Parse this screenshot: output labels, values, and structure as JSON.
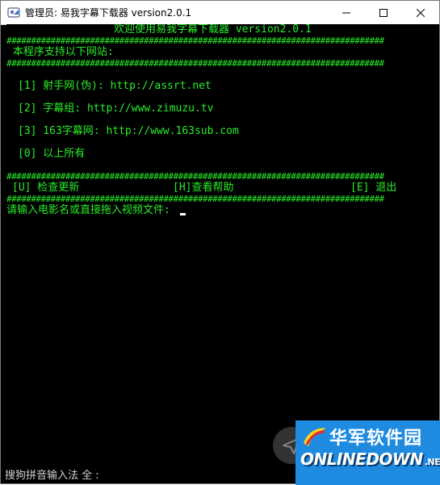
{
  "window": {
    "title": "管理员:  易我字幕下载器 version2.0.1",
    "controls": {
      "minimize": "─",
      "maximize": "☐",
      "close": "✕"
    }
  },
  "console": {
    "welcome": "欢迎使用易我字幕下载器 version2.0.1",
    "hash_line": "#############################################################################",
    "sites_header": " 本程序支持以下网站:",
    "sites": [
      "[1] 射手网(伪): http://assrt.net",
      "[2] 字幕组: http://www.zimuzu.tv",
      "[3] 163字幕网: http://www.163sub.com",
      "[0] 以上所有"
    ],
    "menu": {
      "update": "[U] 检查更新",
      "help": "[H]查看帮助",
      "exit": "[E] 退出"
    },
    "prompt": "请输入电影名或直接拖入视频文件: "
  },
  "ime_status": "搜狗拼音输入法 全 :",
  "watermark": {
    "cn": "华军软件园",
    "en": "ONLINEDOWN",
    "suffix": ".NET"
  },
  "colors": {
    "console_text": "#28ef28",
    "console_bg": "#000000",
    "watermark_bg": "#1f8be0"
  }
}
